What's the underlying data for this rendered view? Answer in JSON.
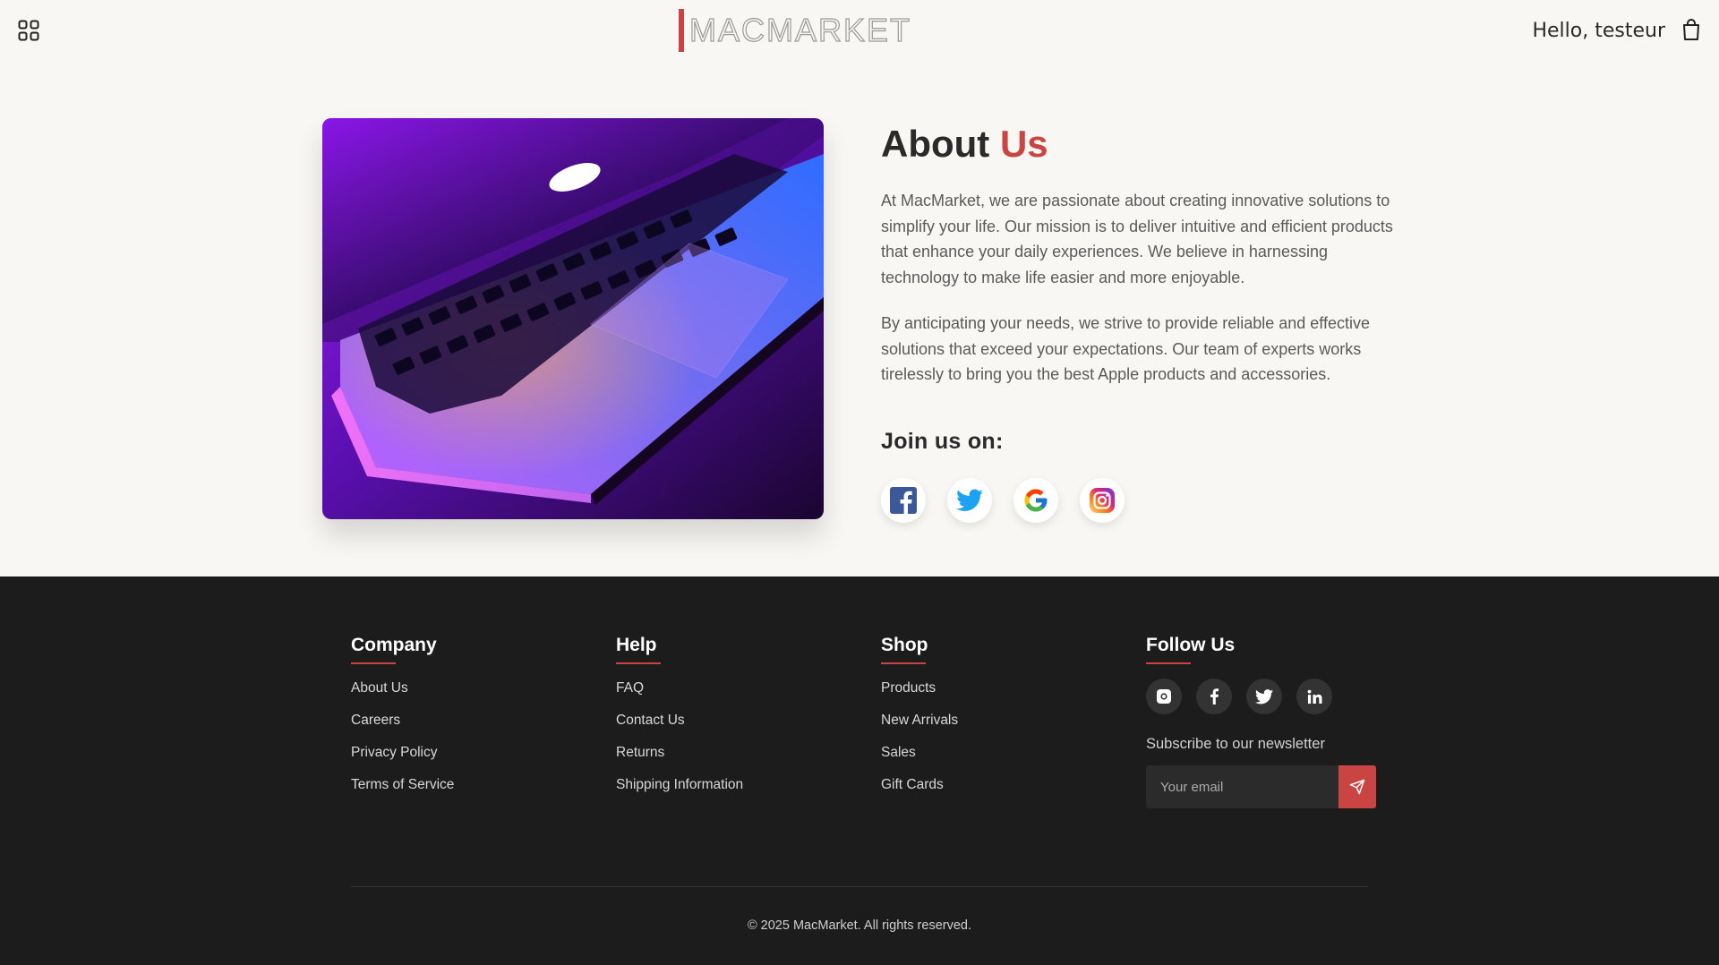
{
  "header": {
    "logo_text": "MACMARKET",
    "greeting": "Hello, testeur"
  },
  "about": {
    "title_main": "About",
    "title_accent": "Us",
    "paragraph1": "At MacMarket, we are passionate about creating innovative solutions to simplify your life. Our mission is to deliver intuitive and efficient products that enhance your daily experiences. We believe in harnessing technology to make life easier and more enjoyable.",
    "paragraph2": "By anticipating your needs, we strive to provide reliable and effective solutions that exceed your expectations. Our team of experts works tirelessly to bring you the best Apple products and accessories.",
    "join_label": "Join us on:",
    "social_icons": [
      "facebook-icon",
      "twitter-icon",
      "google-icon",
      "instagram-icon"
    ]
  },
  "footer": {
    "company": {
      "title": "Company",
      "links": [
        "About Us",
        "Careers",
        "Privacy Policy",
        "Terms of Service"
      ]
    },
    "help": {
      "title": "Help",
      "links": [
        "FAQ",
        "Contact Us",
        "Returns",
        "Shipping Information"
      ]
    },
    "shop": {
      "title": "Shop",
      "links": [
        "Products",
        "New Arrivals",
        "Sales",
        "Gift Cards"
      ]
    },
    "follow": {
      "title": "Follow Us",
      "icons": [
        "instagram-icon",
        "facebook-icon",
        "twitter-icon",
        "linkedin-icon"
      ],
      "newsletter_label": "Subscribe to our newsletter",
      "email_placeholder": "Your email"
    },
    "copyright": "© 2025 MacMarket. All rights reserved."
  },
  "colors": {
    "accent": "#c94442",
    "background": "#f9f7f3",
    "footer_bg": "#1c1c1c"
  }
}
